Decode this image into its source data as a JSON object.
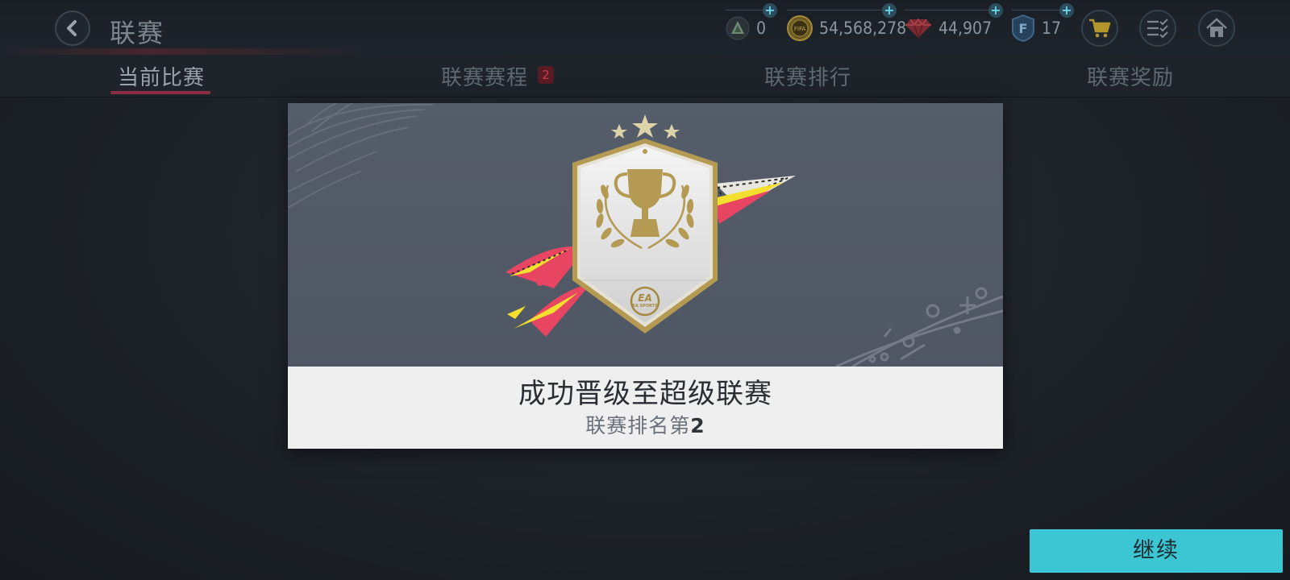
{
  "header": {
    "title": "联赛",
    "currencies": [
      {
        "name": "energy",
        "icon": "leaf-energy-icon",
        "value": "0"
      },
      {
        "name": "coins",
        "icon": "fifa-coin-icon",
        "value": "54,568,278"
      },
      {
        "name": "gems",
        "icon": "gem-icon",
        "value": "44,907"
      },
      {
        "name": "fifa-points",
        "icon": "f-points-icon",
        "value": "17"
      }
    ],
    "buttons": [
      "cart-icon",
      "checklist-icon",
      "home-icon"
    ]
  },
  "tabs": [
    {
      "label": "当前比赛",
      "active": true
    },
    {
      "label": "联赛赛程",
      "badge": "2"
    },
    {
      "label": "联赛排行"
    },
    {
      "label": "联赛奖励"
    }
  ],
  "modal": {
    "badge_text": "EA SPORTS",
    "title": "成功晋级至超级联赛",
    "rank_label": "联赛排名第",
    "rank_value": "2"
  },
  "continue_label": "继续",
  "colors": {
    "accent": "#3cc5d3",
    "tab_underline": "#8c2f45",
    "gold": "#b49a52"
  }
}
